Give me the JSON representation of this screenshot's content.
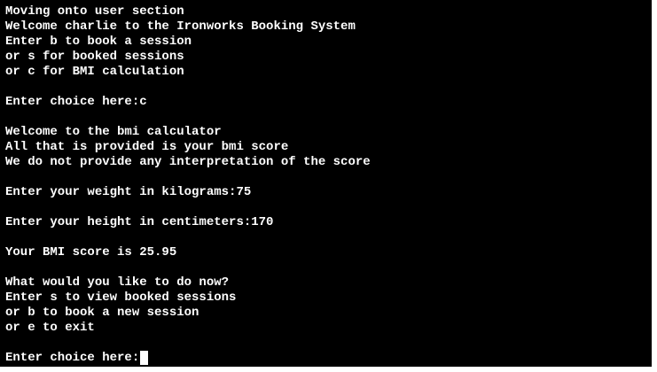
{
  "terminal": {
    "lines": [
      "Moving onto user section",
      "Welcome charlie to the Ironworks Booking System",
      "Enter b to book a session",
      "or s for booked sessions",
      "or c for BMI calculation",
      "",
      "Enter choice here:c",
      "",
      "Welcome to the bmi calculator",
      "All that is provided is your bmi score",
      "We do not provide any interpretation of the score",
      "",
      "Enter your weight in kilograms:75",
      "",
      "Enter your height in centimeters:170",
      "",
      "Your BMI score is 25.95",
      "",
      "What would you like to do now?",
      "Enter s to view booked sessions",
      "or b to book a new session",
      "or e to exit",
      ""
    ],
    "prompt": "Enter choice here:",
    "input_value": ""
  },
  "colors": {
    "background": "#000000",
    "text": "#ffffff",
    "cursor": "#ffffff"
  }
}
